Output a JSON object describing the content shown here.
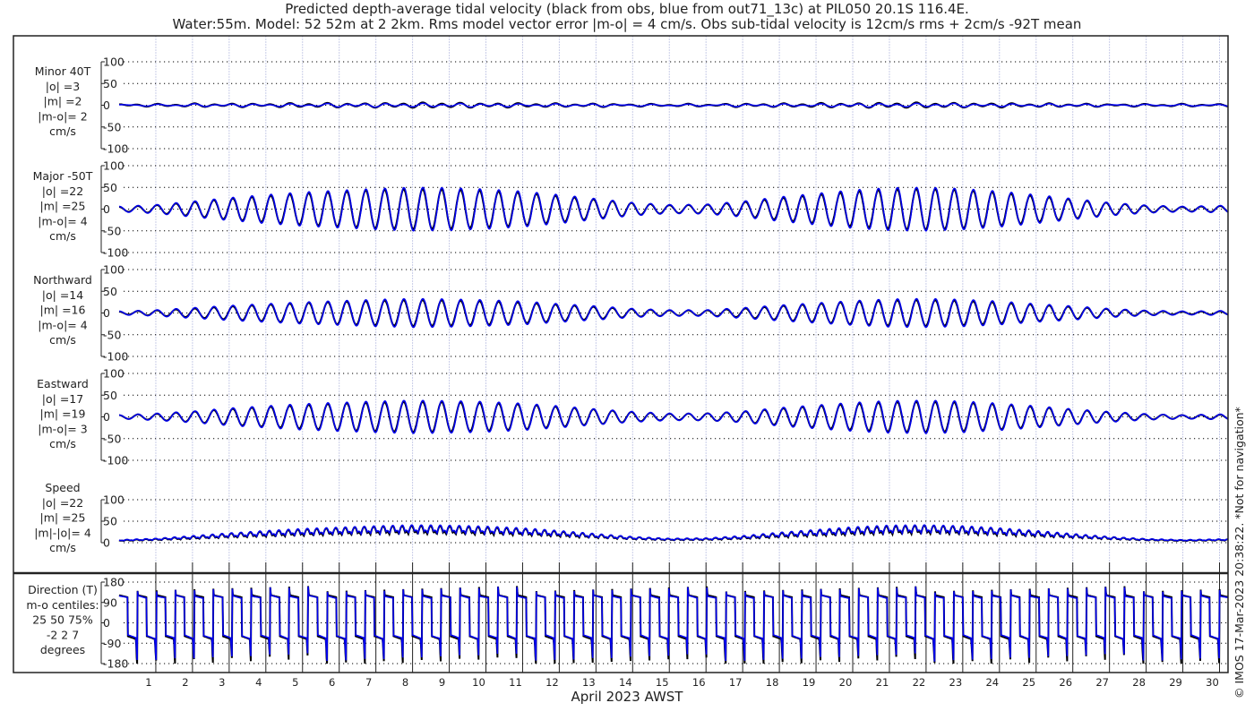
{
  "chart_data": {
    "type": "line",
    "title_lines": [
      "Predicted depth-average tidal velocity (black from obs, blue from out71_13c) at PIL050 20.1S 116.4E.",
      "Water:55m. Model: 52 52m at 2 2km. Rms model vector error |m-o| = 4 cm/s. Obs sub-tidal velocity is 12cm/s rms + 2cm/s -92T mean"
    ],
    "xlabel": "April 2023 AWST",
    "xlim_days": [
      0,
      30.23
    ],
    "xticks": [
      "1",
      "2",
      "3",
      "4",
      "5",
      "6",
      "7",
      "8",
      "9",
      "10",
      "11",
      "12",
      "13",
      "14",
      "15",
      "16",
      "17",
      "18",
      "19",
      "20",
      "21",
      "22",
      "23",
      "24",
      "25",
      "26",
      "27",
      "28",
      "29",
      "30"
    ],
    "legend": {
      "obs": "black",
      "model": "blue"
    },
    "colors": {
      "obs": "#000000",
      "model": "#0000ee",
      "grid_v": "#c9cde8",
      "grid_h": "#000000"
    },
    "envelope_days": [
      0,
      1,
      2,
      3,
      4,
      5,
      6,
      7,
      8,
      9,
      10,
      11,
      12,
      13,
      14,
      15,
      16,
      17,
      18,
      19,
      20,
      21,
      22,
      23,
      24,
      25,
      26,
      27,
      28,
      29,
      30
    ],
    "panels": [
      {
        "key": "minor",
        "label_lines": [
          "Minor 40T",
          "|o| =3",
          "|m| =2",
          "|m-o|= 2",
          "cm/s"
        ],
        "ylim": [
          -100,
          100
        ],
        "yticks": [
          "100",
          "50",
          "0",
          "-50",
          "-100"
        ],
        "ytick_values": [
          100,
          50,
          0,
          -50,
          -100
        ],
        "obs_amplitude_cm_s": [
          2,
          2,
          3,
          3,
          3,
          4,
          4,
          4,
          5,
          5,
          4,
          4,
          3,
          3,
          2,
          2,
          2,
          3,
          3,
          4,
          4,
          5,
          5,
          4,
          4,
          3,
          3,
          2,
          2,
          2,
          2
        ],
        "model_amplitude_cm_s": [
          1,
          1,
          2,
          2,
          2,
          2,
          3,
          3,
          3,
          3,
          3,
          2,
          2,
          2,
          1,
          1,
          1,
          2,
          2,
          2,
          3,
          3,
          3,
          3,
          2,
          2,
          2,
          1,
          1,
          1,
          1
        ]
      },
      {
        "key": "major",
        "label_lines": [
          "Major -50T",
          "|o| =22",
          "|m| =25",
          "|m-o|= 4",
          "cm/s"
        ],
        "ylim": [
          -100,
          100
        ],
        "yticks": [
          "100",
          "50",
          "0",
          "-50",
          "-100"
        ],
        "ytick_values": [
          100,
          50,
          0,
          -50,
          -100
        ],
        "obs_amplitude_cm_s": [
          5,
          9,
          16,
          24,
          30,
          36,
          40,
          44,
          46,
          45,
          42,
          38,
          30,
          22,
          14,
          9,
          10,
          16,
          25,
          33,
          40,
          45,
          47,
          44,
          38,
          30,
          22,
          14,
          8,
          5,
          7
        ],
        "model_amplitude_cm_s": [
          6,
          10,
          18,
          26,
          33,
          39,
          43,
          47,
          50,
          49,
          46,
          41,
          33,
          24,
          15,
          10,
          11,
          18,
          28,
          36,
          44,
          49,
          50,
          47,
          41,
          33,
          24,
          15,
          9,
          6,
          8
        ]
      },
      {
        "key": "northward",
        "label_lines": [
          "Northward",
          "|o| =14",
          "|m| =16",
          "|m-o|= 4",
          "cm/s"
        ],
        "ylim": [
          -100,
          100
        ],
        "yticks": [
          "100",
          "50",
          "0",
          "-50",
          "-100"
        ],
        "ytick_values": [
          100,
          50,
          0,
          -50,
          -100
        ],
        "obs_amplitude_cm_s": [
          3,
          6,
          10,
          15,
          19,
          23,
          26,
          28,
          30,
          29,
          27,
          24,
          19,
          14,
          9,
          6,
          6,
          10,
          16,
          21,
          26,
          29,
          30,
          28,
          24,
          19,
          14,
          9,
          5,
          3,
          4
        ],
        "model_amplitude_cm_s": [
          4,
          7,
          12,
          17,
          21,
          25,
          28,
          31,
          33,
          32,
          30,
          27,
          21,
          16,
          10,
          7,
          7,
          12,
          18,
          23,
          28,
          32,
          33,
          31,
          27,
          21,
          16,
          10,
          6,
          4,
          5
        ]
      },
      {
        "key": "eastward",
        "label_lines": [
          "Eastward",
          "|o| =17",
          "|m| =19",
          "|m-o|= 3",
          "cm/s"
        ],
        "ylim": [
          -100,
          100
        ],
        "yticks": [
          "100",
          "50",
          "0",
          "-50",
          "-100"
        ],
        "ytick_values": [
          100,
          50,
          0,
          -50,
          -100
        ],
        "obs_amplitude_cm_s": [
          4,
          7,
          12,
          18,
          23,
          27,
          31,
          33,
          35,
          34,
          32,
          29,
          23,
          17,
          11,
          7,
          8,
          12,
          19,
          25,
          30,
          34,
          35,
          33,
          29,
          23,
          17,
          11,
          6,
          4,
          5
        ],
        "model_amplitude_cm_s": [
          4,
          8,
          13,
          20,
          25,
          30,
          33,
          36,
          38,
          37,
          35,
          31,
          25,
          18,
          12,
          8,
          8,
          13,
          21,
          27,
          33,
          37,
          38,
          36,
          31,
          25,
          18,
          12,
          7,
          4,
          6
        ]
      },
      {
        "key": "speed",
        "label_lines": [
          "Speed",
          "|o| =22",
          "|m| =25",
          "|m|-|o|= 4",
          "cm/s"
        ],
        "ylim": [
          0,
          100
        ],
        "yticks": [
          "100",
          "50",
          "0"
        ],
        "ytick_values": [
          100,
          50,
          0
        ],
        "obs_amplitude_cm_s": [
          5,
          9,
          16,
          24,
          30,
          36,
          40,
          44,
          46,
          45,
          42,
          38,
          30,
          22,
          14,
          9,
          10,
          16,
          25,
          33,
          40,
          45,
          47,
          44,
          38,
          30,
          22,
          14,
          8,
          5,
          7
        ],
        "model_amplitude_cm_s": [
          6,
          10,
          18,
          26,
          33,
          39,
          43,
          47,
          50,
          49,
          46,
          41,
          33,
          24,
          15,
          10,
          11,
          18,
          28,
          36,
          44,
          49,
          50,
          47,
          41,
          33,
          24,
          15,
          9,
          6,
          8
        ]
      },
      {
        "key": "direction",
        "label_lines": [
          "Direction (T)",
          "m-o centiles:",
          "25  50  75%",
          "-2  2  7",
          "degrees"
        ],
        "ylim": [
          -180,
          180
        ],
        "yticks": [
          "180",
          "90",
          "0",
          "-90",
          "-180"
        ],
        "ytick_values": [
          180,
          90,
          0,
          -90,
          -180
        ],
        "flood_direction_deg": 130,
        "ebb_direction_deg": -50
      }
    ],
    "copyright": "© IMOS 17-Mar-2023 20:38:22. *Not for navigation*"
  }
}
